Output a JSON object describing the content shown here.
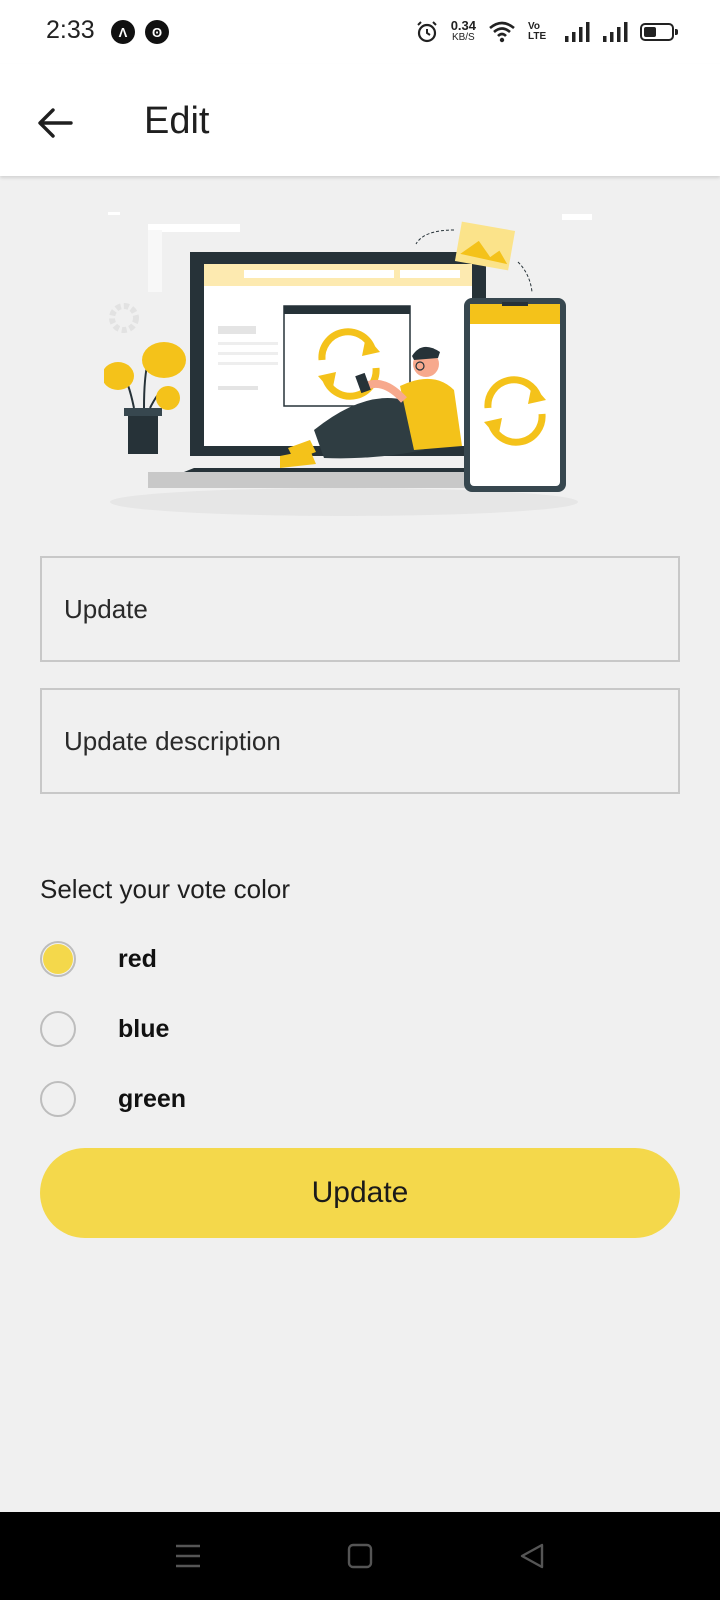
{
  "status_bar": {
    "time": "2:33",
    "app_icons": [
      "Λ",
      "ʘ"
    ],
    "net_speed": "0.34",
    "net_speed_unit": "KB/S",
    "volte": "Vo LTE",
    "icons": [
      "alarm-icon",
      "wifi-icon",
      "volte-icon",
      "signal-icon",
      "signal-icon",
      "battery-icon"
    ],
    "battery_level": 0.45
  },
  "app_bar": {
    "title": "Edit",
    "back_icon": "arrow-left-icon"
  },
  "form": {
    "update_placeholder": "Update",
    "update_value": "",
    "description_placeholder": "Update description",
    "description_value": "",
    "vote_label": "Select your vote color",
    "options": [
      {
        "label": "red",
        "selected": true
      },
      {
        "label": "blue",
        "selected": false
      },
      {
        "label": "green",
        "selected": false
      }
    ],
    "submit_label": "Update"
  },
  "nav_bar": {
    "icons": [
      "menu-icon",
      "home-square-icon",
      "back-triangle-icon"
    ]
  },
  "colors": {
    "accent": "#f4d84b",
    "background": "#f0f0f0",
    "surface": "#ffffff",
    "illustration_dark": "#263238"
  }
}
